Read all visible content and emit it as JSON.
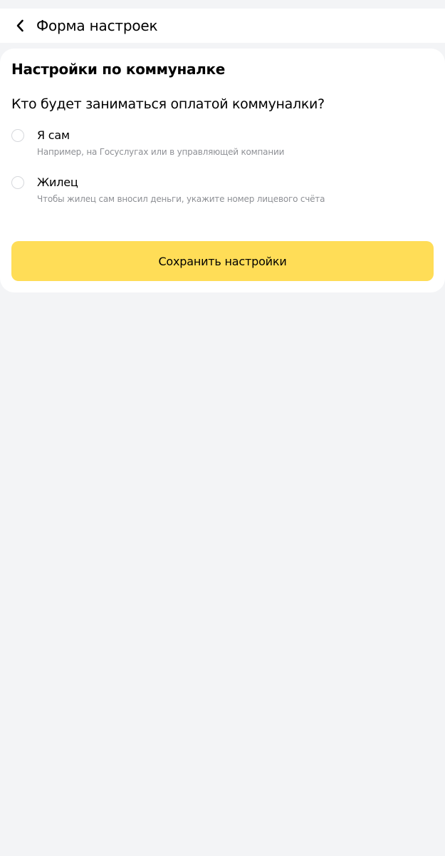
{
  "header": {
    "back_icon": "chevron-left-icon",
    "title": "Форма настроек"
  },
  "form": {
    "title": "Настройки по коммуналке",
    "question": "Кто будет заниматься оплатой коммуналки?",
    "options": [
      {
        "label": "Я сам",
        "hint": "Например, на Госуслугах или в управляющей компании",
        "selected": false
      },
      {
        "label": "Жилец",
        "hint": "Чтобы жилец сам вносил деньги, укажите номер лицевого счёта",
        "selected": false
      }
    ],
    "save_label": "Сохранить настройки"
  },
  "colors": {
    "background": "#f3f4f6",
    "card": "#ffffff",
    "accent_button": "#ffdd57",
    "hint_text": "#8e9095",
    "radio_border": "#d6d8dc"
  }
}
